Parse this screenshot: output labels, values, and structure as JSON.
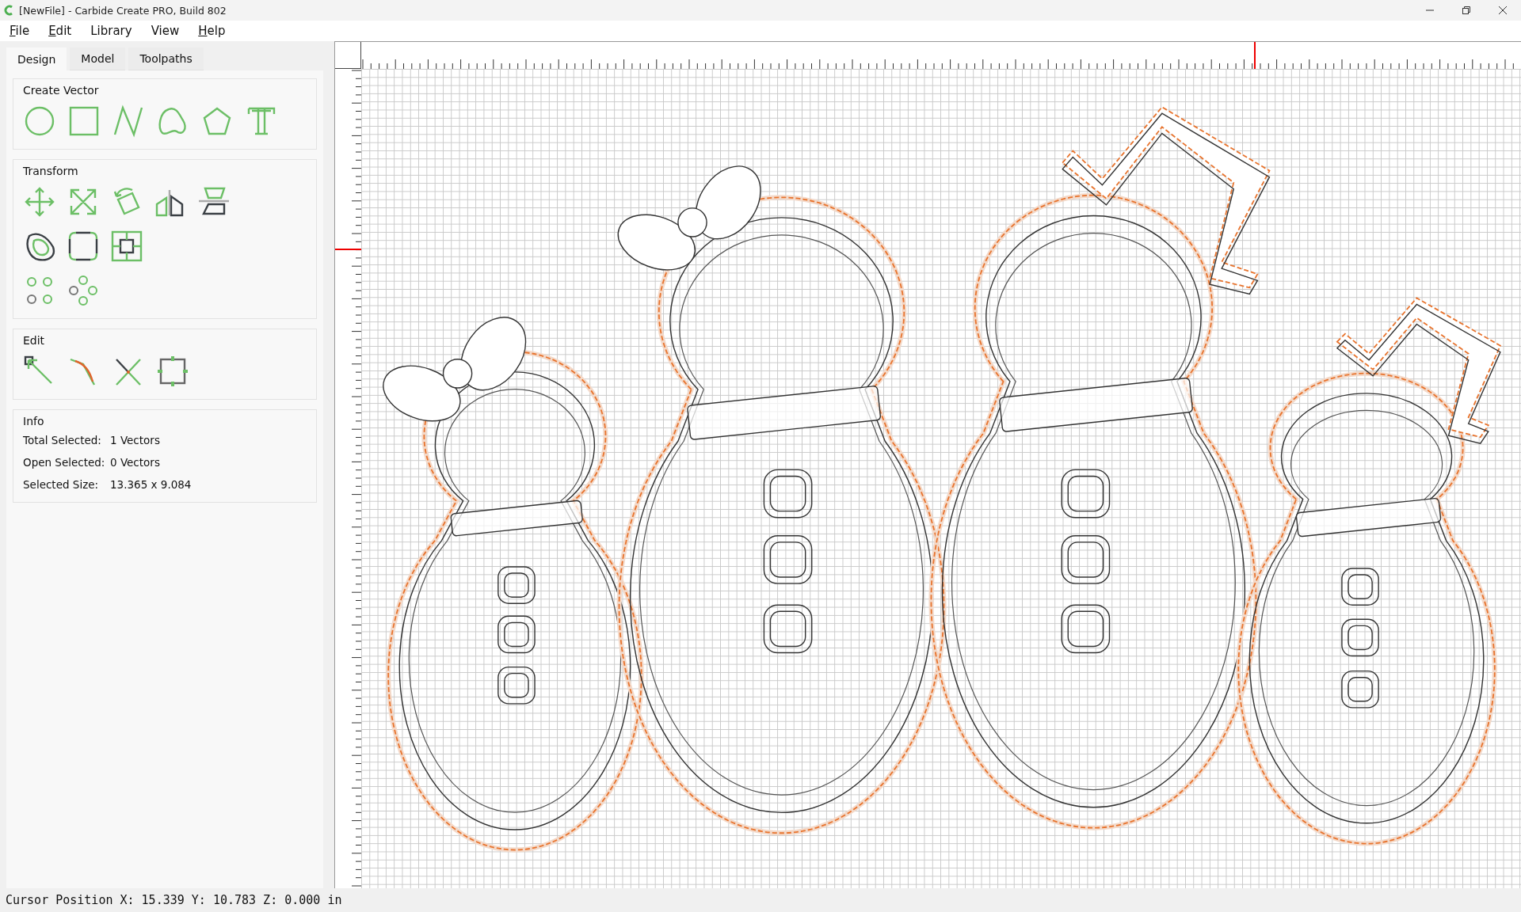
{
  "window": {
    "title": "[NewFile] - Carbide Create PRO, Build 802"
  },
  "menu": [
    {
      "label": "File",
      "underline_first": true
    },
    {
      "label": "Edit",
      "underline_first": true
    },
    {
      "label": "Library",
      "underline_first": false
    },
    {
      "label": "View",
      "underline_first": false
    },
    {
      "label": "Help",
      "underline_first": true
    }
  ],
  "tabs": [
    {
      "label": "Design",
      "selected": true
    },
    {
      "label": "Model",
      "selected": false
    },
    {
      "label": "Toolpaths",
      "selected": false
    }
  ],
  "sections": [
    {
      "title": "Create Vector",
      "kind": "create"
    },
    {
      "title": "Transform",
      "kind": "transform"
    },
    {
      "title": "Edit",
      "kind": "edit"
    }
  ],
  "info": {
    "title": "Info",
    "rows": [
      {
        "label": "Total Selected:",
        "value": "1 Vectors"
      },
      {
        "label": "Open Selected:",
        "value": "0 Vectors"
      },
      {
        "label": "Selected Size:",
        "value": "13.365 x 9.084"
      }
    ]
  },
  "status_bar": "Cursor Position X: 15.339 Y: 10.783 Z: 0.000 in"
}
